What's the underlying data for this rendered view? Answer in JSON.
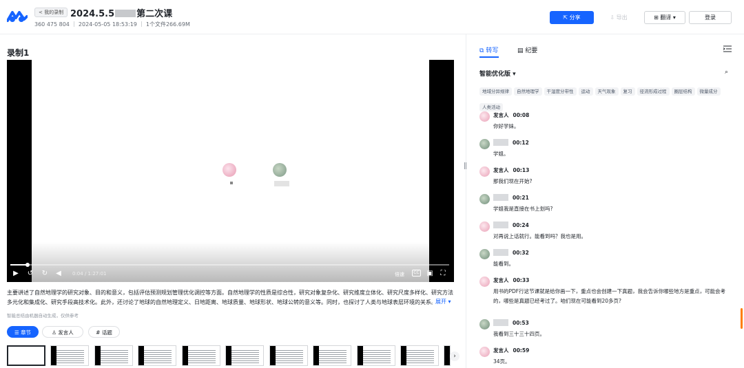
{
  "header": {
    "back_label": "< 我的录制",
    "title_prefix": "2024.5.5",
    "title_suffix": "第二次课",
    "meeting_id": "360 475 804",
    "datetime": "2024-05-05 18:53:19",
    "file_info": "1个文件266.69M",
    "share_label": "分享",
    "export_label": "导出",
    "translate_label": "翻译",
    "login_label": "登录",
    "brand_color": "#1664ff"
  },
  "left": {
    "recording_title": "录制1",
    "video": {
      "time": "0:04 / 1:27:01",
      "speed": "倍速",
      "cc": "CC",
      "progress": 0.04
    },
    "summary": "主要讲述了自然地理学的研究对象、目的和意义，包括评估预测规划管理优化调控等方面。自然地理学的性质是综合性，研究对象复杂化、研究维度立体化、研究尺度多样化、研究方法多元化和集成化、研究手段高技术化。此外，还讨论了地球的自然地理定义、日地距离、地球质量、地球形状、地球公转的意义等。同时，也探讨了人类与地球表层环境的关系。",
    "expand_label": "展开",
    "ai_note": "智能总结由机器自动生成，仅供参考",
    "tabs": [
      {
        "label": "章节",
        "icon": "list-icon"
      },
      {
        "label": "发言人",
        "icon": "user-icon"
      },
      {
        "label": "话题",
        "icon": "hash-icon"
      }
    ]
  },
  "right": {
    "tabs": [
      {
        "label": "转写",
        "icon": "transcript-icon"
      },
      {
        "label": "纪要",
        "icon": "minutes-icon"
      }
    ],
    "mode_label": "智能优化版",
    "keywords": [
      "地域分异规律",
      "自然地理学",
      "干湿度分带性",
      "运动",
      "天气现象",
      "复习",
      "径流形成过程",
      "圈层结构",
      "微量成分",
      "人类活动"
    ],
    "messages": [
      {
        "speaker": "发言人",
        "time": "00:08",
        "text": "你好学妹。",
        "avatar": "pink"
      },
      {
        "speaker": "",
        "time": "00:12",
        "text": "学姐。",
        "avatar": "green"
      },
      {
        "speaker": "发言人",
        "time": "00:13",
        "text": "那我们现在开始?",
        "avatar": "pink"
      },
      {
        "speaker": "",
        "time": "00:21",
        "text": "学姐我是直接在书上划吗?",
        "avatar": "green"
      },
      {
        "speaker": "",
        "time": "00:24",
        "text": "对再说上话就行。能看到吗？我也是用。",
        "avatar": "pink"
      },
      {
        "speaker": "",
        "time": "00:32",
        "text": "能看到。",
        "avatar": "green"
      },
      {
        "speaker": "发言人",
        "time": "00:33",
        "text": "用书的PDF行这节课就是给你画一下，重点也会创建一下真题，我会告诉你哪些地方是重点，可能会考的，哪些是真题已经考过了。咱们现在可能看到20多页?",
        "avatar": "pink"
      },
      {
        "speaker": "",
        "time": "00:53",
        "text": "我看到三十三十四页。",
        "avatar": "green"
      },
      {
        "speaker": "发言人",
        "time": "00:59",
        "text": "34页。",
        "avatar": "pink"
      }
    ]
  }
}
